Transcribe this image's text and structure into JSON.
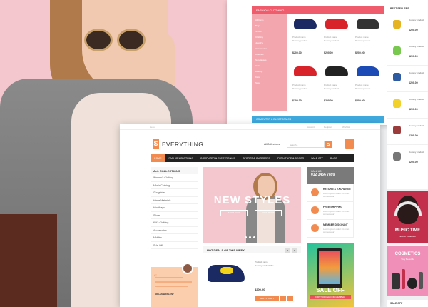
{
  "background_photo": {
    "colors": {
      "pink": "#f4c6cd"
    }
  },
  "top_window": {
    "fashion_header": "FASHION CLOTHING",
    "side_items": [
      "All Items",
      "Bags",
      "Shoes",
      "Clothing",
      "Jewelry",
      "Accessories",
      "Watches",
      "Sunglasses",
      "Hats",
      "Beauty",
      "Kids",
      "Sale"
    ],
    "products": [
      {
        "desc": "Product name",
        "sub": "Dummy product",
        "price": "$200.00"
      },
      {
        "desc": "Product name",
        "sub": "Dummy product",
        "price": "$200.00"
      },
      {
        "desc": "Product name",
        "sub": "Dummy product",
        "price": "$200.00"
      },
      {
        "desc": "Product name",
        "sub": "Dummy product",
        "price": "$200.00"
      },
      {
        "desc": "Product name",
        "sub": "Dummy product",
        "price": "$200.00"
      },
      {
        "desc": "Product name",
        "sub": "Dummy product",
        "price": "$200.00"
      }
    ],
    "computer_header": "COMPUTER & ELECTRONICS"
  },
  "best_sellers": {
    "title": "BEST SELLERS",
    "items": [
      {
        "title": "Dummy product",
        "price": "$200.00",
        "color": "#e6b422"
      },
      {
        "title": "Dummy product",
        "price": "$200.00",
        "color": "#78c850"
      },
      {
        "title": "Dummy product",
        "price": "$200.00",
        "color": "#2d5aa0"
      },
      {
        "title": "Dummy product",
        "price": "$200.00",
        "color": "#f2d22a"
      },
      {
        "title": "Dummy product",
        "price": "$200.00",
        "color": "#9c3b3b"
      },
      {
        "title": "Dummy product",
        "price": "$200.00",
        "color": "#777777"
      }
    ]
  },
  "promo_music": {
    "title": "MUSIC TIME",
    "sub": "Stereo Collection"
  },
  "promo_cosmetics": {
    "title": "COSMETICS",
    "sub": "Stay Beautiful"
  },
  "promo_sale": {
    "title": "SALE OFF"
  },
  "store": {
    "topbar": {
      "greeting": "Hello",
      "account": "Account",
      "login": "Register",
      "wishlist": "Wishlist"
    },
    "logo_letter": "S",
    "logo_name": "EVERYTHING",
    "search": {
      "category": "All Collections",
      "placeholder": "Search..."
    },
    "nav": [
      "HOME",
      "FASHION CLOTHING",
      "COMPUTER & ELECTRONICS",
      "SPORTS & OUTDOORS",
      "FURNITURE & DECOR",
      "SALE OFF",
      "BLOG"
    ],
    "collections_title": "ALL COLLECTIONS",
    "categories": [
      "Women's Clothing",
      "Men's Clothing",
      "Gadgetries",
      "Home Materials",
      "Handbags",
      "Shoes",
      "Kid's Clothing",
      "Accessories",
      "Mobiles",
      "Sale Off"
    ],
    "quote_author": "LOGAN WINSLOW",
    "hero": {
      "title": "NEW STYLES",
      "btn1": "SHOP NOW",
      "btn2": "VIEW MORE"
    },
    "hot_deals_title": "HOT DEALS OF THIS WEEK",
    "hot_item": {
      "meta1": "Product name",
      "meta2": "Dummy product title",
      "price": "$200.00",
      "add": "ADD TO CART"
    },
    "call_us": {
      "label": "CALL US",
      "number": "012 3456 7899"
    },
    "services": [
      {
        "title": "RETURN & EXCHANGE",
        "desc": "Lorem ipsum dolor sit amet consectetur"
      },
      {
        "title": "FREE SHIPPING",
        "desc": "Lorem ipsum dolor sit amet consectetur"
      },
      {
        "title": "MEMBER DISCOUNT",
        "desc": "Lorem ipsum dolor sit amet consectetur"
      }
    ],
    "tablet_promo": {
      "title": "SALE OFF",
      "sub": "FIRST ORDER FOR MEMBER"
    }
  }
}
